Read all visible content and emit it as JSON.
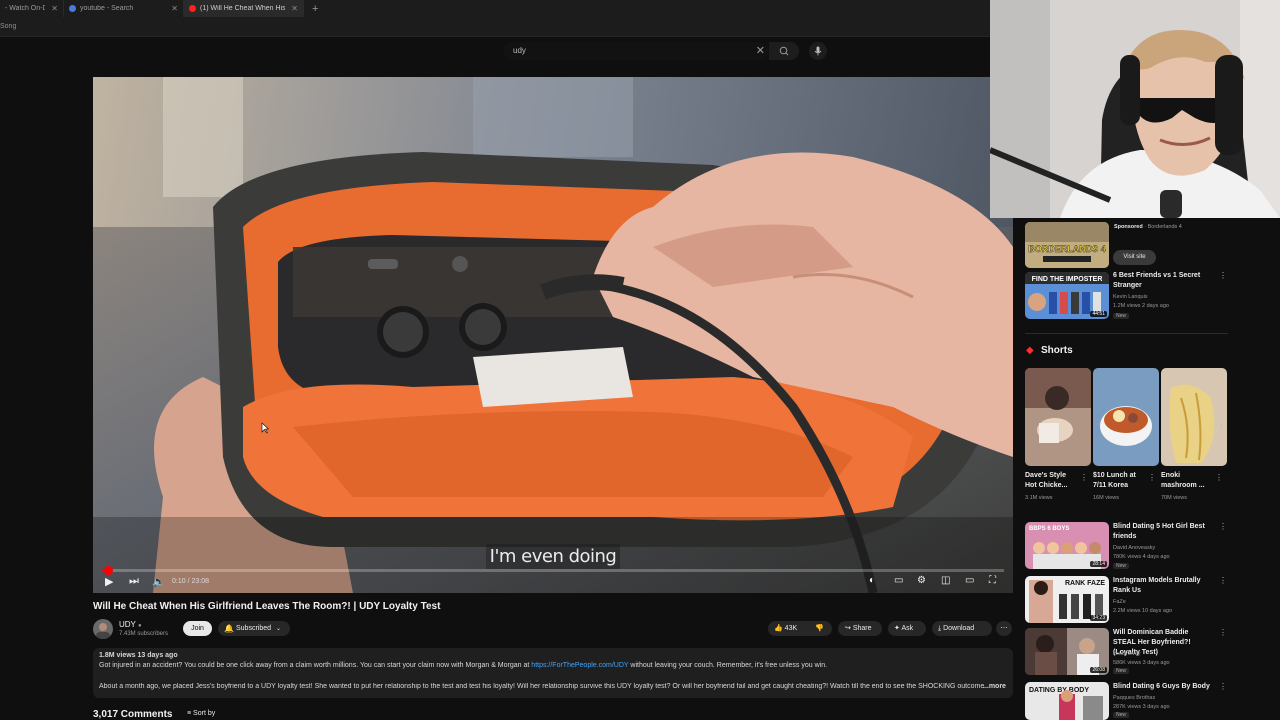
{
  "browser": {
    "tabs": [
      {
        "label": "- Watch On-Demand",
        "active": false
      },
      {
        "label": "youtube - Search",
        "active": false
      },
      {
        "label": "(1) Will He Cheat When His Girlfri...",
        "active": true
      }
    ],
    "bookmark_text": "Song"
  },
  "search": {
    "value": "udy"
  },
  "player": {
    "caption": "I'm even doing",
    "time": "0:10 / 23:08",
    "progress": 0.007
  },
  "video": {
    "title": "Will He Cheat When His Girlfriend Leaves The Room?! | UDY Loyalty Test",
    "channel": "UDY",
    "subscribers": "7.43M subscribers",
    "join_label": "Join",
    "subscribed_label": "Subscribed",
    "likes": "43K",
    "share_label": "Share",
    "ask_label": "Ask",
    "download_label": "Download",
    "views_date": "1.8M views  13 days ago",
    "desc_line1": "Got injured in an accident? You could be one click away from a claim worth millions. You can start your claim now with Morgan & Morgan at",
    "desc_link": "https://ForThePeople.com/UDY",
    "desc_line1b": "without leaving your couch. Remember, it's free unless you win.",
    "desc_line2": "About a month ago, we placed Jess's boyfriend to a UDY loyalty test! She wanted to put her relationship to the test and test his loyalty! Will her relationship survive this UDY loyalty test? Or will her boyfriend fail and get caught cheating?! Watch till the end to see the SHOCKING outcome!",
    "more_label": "...more",
    "comments_count": "3,017 Comments",
    "sort_label": "Sort by"
  },
  "sidebar": {
    "ad": {
      "sponsored": "Sponsored",
      "advertiser": "Borderlands 4",
      "cta": "Visit site",
      "logo_text": "BORDERLANDS 4"
    },
    "top_video": {
      "title": "6 Best Friends vs 1 Secret Stranger",
      "channel": "Kevin Lanquis",
      "meta": "1.2M views  2 days ago",
      "badge": "New",
      "duration": "44:51",
      "thumb_text": "FIND THE IMPOSTER"
    },
    "shorts_heading": "Shorts",
    "shorts": [
      {
        "title": "Dave's Style Hot Chicke...",
        "views": "3.1M views"
      },
      {
        "title": "$10 Lunch at 7/11 Korea",
        "views": "16M views"
      },
      {
        "title": "Enoki mashroom ...",
        "views": "70M views"
      }
    ],
    "videos": [
      {
        "title": "Blind Dating 5 Hot Girl Best friends",
        "channel": "David Anoveasky",
        "meta": "780K views  4 days ago",
        "badge": "New",
        "duration": "28:14",
        "thumb_text": "BBPS  6 BOYS"
      },
      {
        "title": "Instagram Models Brutally Rank Us",
        "channel": "FaZe",
        "meta": "2.2M views  10 days ago",
        "badge": "",
        "duration": "34:23",
        "thumb_text": "RANK FAZE"
      },
      {
        "title": "Will Dominican Baddie STEAL Her Boyfriend?! (Loyalty Test)",
        "channel": "xoudylovey",
        "meta": "586K views  3 days ago",
        "badge": "New",
        "duration": "26:08",
        "thumb_text": ""
      },
      {
        "title": "Blind Dating 6 Guys By Body",
        "channel": "Paqques Brothas",
        "meta": "287K views  3 days ago",
        "badge": "New",
        "duration": "",
        "thumb_text": "DATING BY BODY"
      }
    ]
  }
}
